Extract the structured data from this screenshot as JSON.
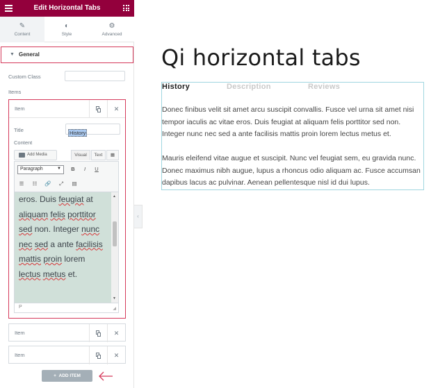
{
  "editor": {
    "title": "Edit Horizontal Tabs",
    "tabs": [
      {
        "label": "Content"
      },
      {
        "label": "Style"
      },
      {
        "label": "Advanced"
      }
    ],
    "section_title": "General",
    "custom_class_label": "Custom Class",
    "items_label": "Items",
    "active_item": {
      "name": "Item",
      "title_label": "Title",
      "title_value": "History",
      "content_label": "Content",
      "add_media_label": "Add Media",
      "visual_tab": "Visual",
      "text_tab": "Text",
      "format_select": "Paragraph",
      "editor_status": "P"
    },
    "other_items": [
      {
        "name": "Item"
      },
      {
        "name": "Item"
      }
    ],
    "add_item_label": "ADD ITEM"
  },
  "preview": {
    "title": "Qi horizontal tabs",
    "tabs": [
      {
        "label": "History"
      },
      {
        "label": "Description"
      },
      {
        "label": "Reviews"
      }
    ],
    "paragraphs": [
      [
        "Donec finibus velit sit amet arcu suscipit convallis. Fusce vel urna sit amet nisi",
        "tempor iaculis ac vitae eros. Duis feugiat at aliquam felis porttitor sed non.",
        "Integer nunc nec sed a ante facilisis mattis proin lorem lectus metus et."
      ],
      [
        "Mauris eleifend vitae augue et suscipit. Nunc vel feugiat sem, eu gravida nunc.",
        "Donec maximus nibh augue, lupus a rhoncus odio aliquam ac. Fusce accumsan",
        "dapibus lacus ac pulvinar. Aenean pellentesque nisl id dui lupus."
      ]
    ]
  },
  "colors": {
    "topbar": "#93003c",
    "highlight_border": "#d5395a",
    "editor_bg": "#d0e0d9",
    "preview_border": "#9fd6e0"
  }
}
